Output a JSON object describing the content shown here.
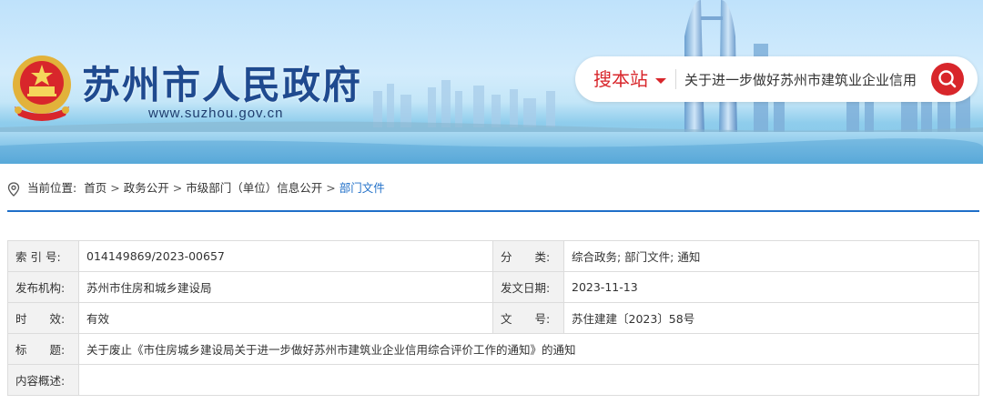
{
  "header": {
    "site_title": "苏州市人民政府",
    "site_url": "www.suzhou.gov.cn",
    "logo_icon": "national-emblem-icon"
  },
  "search": {
    "scope_label": "搜本站",
    "query": "关于进一步做好苏州市建筑业企业信用",
    "button_icon": "search-icon"
  },
  "breadcrumb": {
    "prefix": "当前位置:",
    "items": [
      "首页",
      "政务公开",
      "市级部门（单位）信息公开",
      "部门文件"
    ],
    "separator": ">"
  },
  "info": {
    "index_label": "索 引 号:",
    "index_value": "014149869/2023-00657",
    "category_label": "分　　类:",
    "category_value": "综合政务;  部门文件;  通知",
    "publisher_label": "发布机构:",
    "publisher_value": "苏州市住房和城乡建设局",
    "date_label": "发文日期:",
    "date_value": "2023-11-13",
    "validity_label": "时　　效:",
    "validity_value": "有效",
    "docno_label": "文　　号:",
    "docno_value": "苏住建建〔2023〕58号",
    "title_label": "标　　题:",
    "title_value": "关于废止《市住房城乡建设局关于进一步做好苏州市建筑业企业信用综合评价工作的通知》的通知",
    "summary_label": "内容概述:",
    "summary_value": ""
  },
  "colors": {
    "accent_red": "#d8262b",
    "title_blue": "#1f4a8f",
    "link_blue": "#1f6fc8",
    "label_bg": "#f2f2f2",
    "border": "#dcdcdc"
  }
}
